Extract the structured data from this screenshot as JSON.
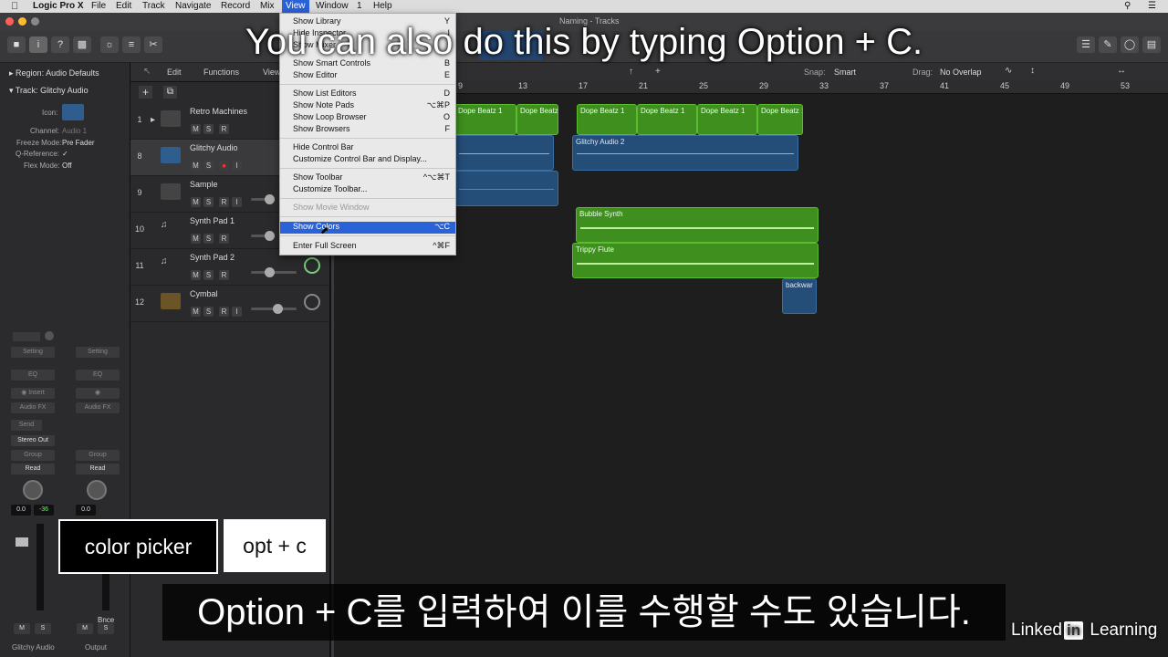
{
  "menubar": {
    "apple": "",
    "app_name": "Logic Pro X",
    "items": [
      "File",
      "Edit",
      "Track",
      "Navigate",
      "Record",
      "Mix",
      "View",
      "Window",
      "1",
      "Help"
    ],
    "active_item": "View"
  },
  "window_title": "Naming - Tracks",
  "caption_en": "You can also do this by typing Option + C.",
  "caption_kr": "Option + C를 입력하여 이를 수행할 수도 있습니다.",
  "overlay_keys": {
    "label": "color picker",
    "shortcut": "opt + c"
  },
  "branding": {
    "brand_a": "Linked",
    "brand_in": "in",
    "brand_b": "Learning"
  },
  "inspector": {
    "region_label": "Region:",
    "region_value": "Audio Defaults",
    "track_label": "Track:",
    "track_value": "Glitchy Audio",
    "icon_label": "Icon:",
    "channel_label": "Channel:",
    "channel_value": "Audio 1",
    "freeze_label": "Freeze Mode:",
    "freeze_value": "Pre Fader",
    "qref_label": "Q-Reference:",
    "qref_value": "✓",
    "flex_label": "Flex Mode:",
    "flex_value": "Off",
    "strip1": {
      "setting": "Setting",
      "eq": "EQ",
      "insert": "Insert",
      "audiofx": "Audio FX",
      "send": "Send",
      "output": "Stereo Out",
      "group": "Group",
      "auto": "Read",
      "vol": "0.0",
      "pan": "-36",
      "m": "M",
      "s": "S",
      "name": "Glitchy Audio"
    },
    "strip2": {
      "setting": "Setting",
      "eq": "EQ",
      "audiofx": "Audio FX",
      "group": "Group",
      "auto": "Read",
      "vol": "0.0",
      "bnce": "Bnce",
      "m": "M",
      "s": "S",
      "name": "Output"
    }
  },
  "track_toolbar": {
    "edit": "Edit",
    "functions": "Functions",
    "view": "View",
    "snap_label": "Snap:",
    "snap_value": "Smart",
    "drag_label": "Drag:",
    "drag_value": "No Overlap"
  },
  "tracks": [
    {
      "num": "1",
      "name": "Retro Machines",
      "m": "M",
      "s": "S",
      "r": "R"
    },
    {
      "num": "8",
      "name": "Glitchy Audio",
      "m": "M",
      "s": "S",
      "r": "R",
      "i": "I"
    },
    {
      "num": "9",
      "name": "Sample",
      "m": "M",
      "s": "S",
      "r": "R",
      "i": "I"
    },
    {
      "num": "10",
      "name": "Synth Pad 1",
      "m": "M",
      "s": "S",
      "r": "R"
    },
    {
      "num": "11",
      "name": "Synth Pad 2",
      "m": "M",
      "s": "S",
      "r": "R"
    },
    {
      "num": "12",
      "name": "Cymbal",
      "m": "M",
      "s": "S",
      "r": "R",
      "i": "I"
    }
  ],
  "ruler": [
    "9",
    "13",
    "17",
    "21",
    "25",
    "29",
    "33",
    "37",
    "41",
    "45",
    "49",
    "53"
  ],
  "regions": {
    "dope": "Dope Beatz 1",
    "glitchy2": "Glitchy Audio 2",
    "bubble": "Bubble Synth",
    "trippy": "Trippy Flute",
    "backwar": "backwar"
  },
  "view_menu": {
    "items": [
      {
        "label": "Show Library",
        "shortcut": "Y"
      },
      {
        "label": "Hide Inspector",
        "shortcut": "I"
      },
      {
        "label": "Show Mixer",
        "shortcut": ""
      },
      {
        "label": "Show Smart Controls",
        "shortcut": "B"
      },
      {
        "label": "Show Editor",
        "shortcut": "E"
      },
      {
        "label": "Show List Editors",
        "shortcut": "D"
      },
      {
        "label": "Show Note Pads",
        "shortcut": "⌥⌘P"
      },
      {
        "label": "Show Loop Browser",
        "shortcut": "O"
      },
      {
        "label": "Show Browsers",
        "shortcut": "F"
      },
      {
        "label": "Hide Control Bar",
        "shortcut": ""
      },
      {
        "label": "Customize Control Bar and Display...",
        "shortcut": ""
      },
      {
        "label": "Show Toolbar",
        "shortcut": "^⌥⌘T"
      },
      {
        "label": "Customize Toolbar...",
        "shortcut": ""
      },
      {
        "label": "Show Movie Window",
        "shortcut": ""
      },
      {
        "label": "Show Colors",
        "shortcut": "⌥C"
      },
      {
        "label": "Enter Full Screen",
        "shortcut": "^⌘F"
      }
    ]
  },
  "colors": {
    "accent": "#2a62d8",
    "region_green": "#3e8f1e",
    "region_blue": "#244d78"
  }
}
